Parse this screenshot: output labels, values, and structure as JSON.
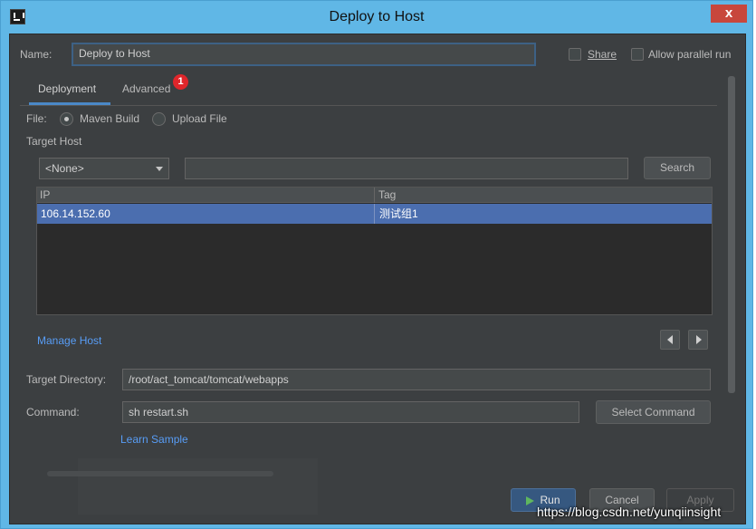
{
  "window": {
    "title": "Deploy to Host",
    "close_glyph": "x"
  },
  "name": {
    "label": "Name:",
    "value": "Deploy to Host"
  },
  "options": {
    "share_label": "Share",
    "allow_parallel_label": "Allow parallel run"
  },
  "tabs": [
    {
      "label": "Deployment",
      "active": true
    },
    {
      "label": "Advanced",
      "badge": "1"
    }
  ],
  "file": {
    "label": "File:",
    "options": [
      "Maven Build",
      "Upload File"
    ],
    "selected": "Maven Build"
  },
  "target_host": {
    "label": "Target Host",
    "select_value": "<None>",
    "search_value": "",
    "search_button": "Search"
  },
  "host_table": {
    "columns": [
      "IP",
      "Tag"
    ],
    "rows": [
      {
        "ip": "106.14.152.60",
        "tag": "测试组1"
      }
    ]
  },
  "manage_host_link": "Manage Host",
  "target_directory": {
    "label": "Target Directory:",
    "value": "/root/act_tomcat/tomcat/webapps"
  },
  "command": {
    "label": "Command:",
    "value": "sh restart.sh",
    "select_button": "Select Command",
    "learn_link": "Learn Sample"
  },
  "footer": {
    "run": "Run",
    "cancel": "Cancel",
    "apply": "Apply"
  },
  "watermark": "https://blog.csdn.net/yunqiinsight",
  "colors": {
    "titlebar": "#60b7e6",
    "panel": "#3c3f41",
    "accent": "#4a88c7",
    "selection": "#4b6eaf",
    "link": "#589df6",
    "badge": "#e0262b"
  },
  "icons": {
    "app": "intellij-icon",
    "close": "close-icon",
    "run": "play-icon",
    "prev": "arrow-left-icon",
    "next": "arrow-right-icon",
    "dropdown": "chevron-down-icon"
  }
}
